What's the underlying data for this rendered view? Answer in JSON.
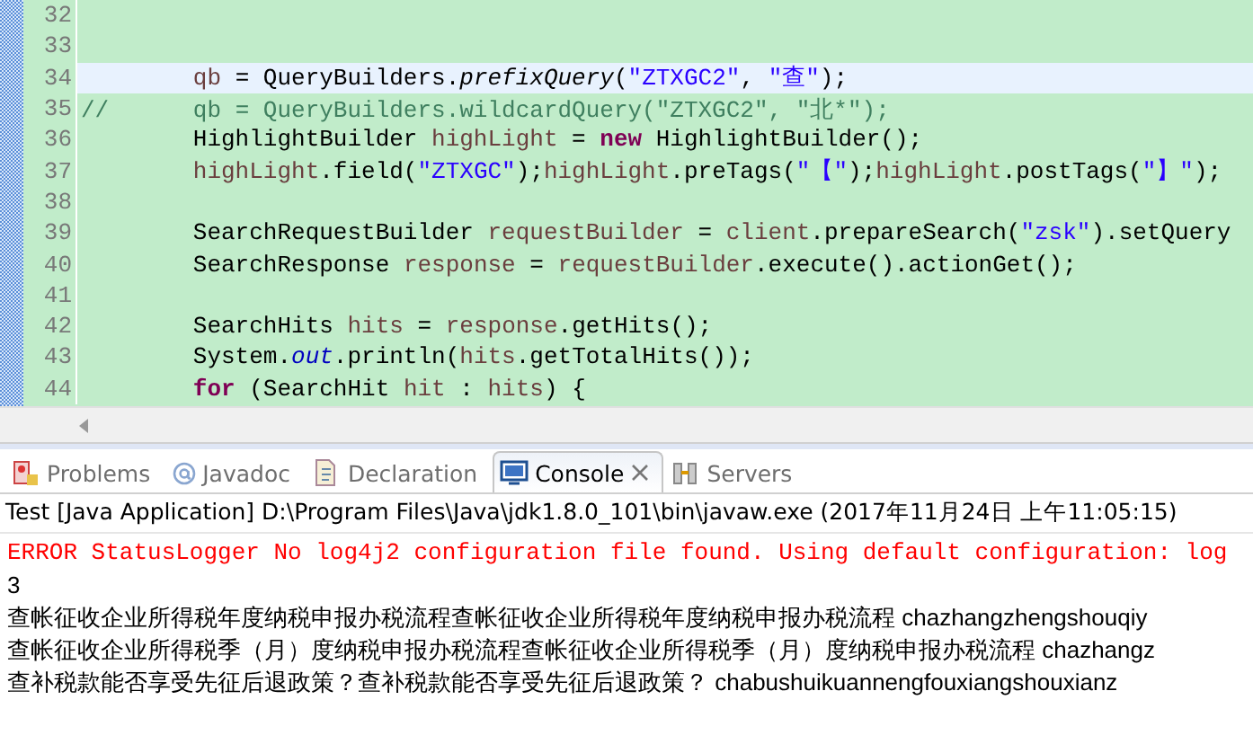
{
  "editor": {
    "lines": [
      {
        "number": "32",
        "selected": false
      },
      {
        "number": "33",
        "selected": false
      },
      {
        "number": "34",
        "selected": true,
        "indent": true,
        "tokens": [
          {
            "kind": "var",
            "text": "qb"
          },
          {
            "kind": "plain",
            "text": " = QueryBuilders."
          },
          {
            "kind": "italic",
            "text": "prefixQuery"
          },
          {
            "kind": "plain",
            "text": "("
          },
          {
            "kind": "string",
            "text": "\"ZTXGC2\""
          },
          {
            "kind": "plain",
            "text": ", "
          },
          {
            "kind": "string",
            "text": "\"查\""
          },
          {
            "kind": "plain",
            "text": ");"
          }
        ]
      },
      {
        "number": "35",
        "selected": false,
        "indent": false,
        "tokens": [
          {
            "kind": "comment",
            "text": "//      qb = QueryBuilders.wildcardQuery(\"ZTXGC2\", \"北*\");"
          }
        ]
      },
      {
        "number": "36",
        "selected": false,
        "indent": true,
        "tokens": [
          {
            "kind": "plain",
            "text": "HighlightBuilder "
          },
          {
            "kind": "var",
            "text": "highLight"
          },
          {
            "kind": "plain",
            "text": " = "
          },
          {
            "kind": "keyword",
            "text": "new"
          },
          {
            "kind": "plain",
            "text": " HighlightBuilder();"
          }
        ]
      },
      {
        "number": "37",
        "selected": false,
        "indent": true,
        "tokens": [
          {
            "kind": "var",
            "text": "highLight"
          },
          {
            "kind": "plain",
            "text": ".field("
          },
          {
            "kind": "string",
            "text": "\"ZTXGC\""
          },
          {
            "kind": "plain",
            "text": ");"
          },
          {
            "kind": "var",
            "text": "highLight"
          },
          {
            "kind": "plain",
            "text": ".preTags("
          },
          {
            "kind": "string",
            "text": "\"【\""
          },
          {
            "kind": "plain",
            "text": ");"
          },
          {
            "kind": "var",
            "text": "highLight"
          },
          {
            "kind": "plain",
            "text": ".postTags("
          },
          {
            "kind": "string",
            "text": "\"】\""
          },
          {
            "kind": "plain",
            "text": ");"
          }
        ]
      },
      {
        "number": "38",
        "selected": false
      },
      {
        "number": "39",
        "selected": false,
        "indent": true,
        "tokens": [
          {
            "kind": "plain",
            "text": "SearchRequestBuilder "
          },
          {
            "kind": "var",
            "text": "requestBuilder"
          },
          {
            "kind": "plain",
            "text": " = "
          },
          {
            "kind": "var",
            "text": "client"
          },
          {
            "kind": "plain",
            "text": ".prepareSearch("
          },
          {
            "kind": "string",
            "text": "\"zsk\""
          },
          {
            "kind": "plain",
            "text": ").setQuery"
          }
        ]
      },
      {
        "number": "40",
        "selected": false,
        "indent": true,
        "tokens": [
          {
            "kind": "plain",
            "text": "SearchResponse "
          },
          {
            "kind": "var",
            "text": "response"
          },
          {
            "kind": "plain",
            "text": " = "
          },
          {
            "kind": "var",
            "text": "requestBuilder"
          },
          {
            "kind": "plain",
            "text": ".execute().actionGet();"
          }
        ]
      },
      {
        "number": "41",
        "selected": false
      },
      {
        "number": "42",
        "selected": false,
        "indent": true,
        "tokens": [
          {
            "kind": "plain",
            "text": "SearchHits "
          },
          {
            "kind": "var",
            "text": "hits"
          },
          {
            "kind": "plain",
            "text": " = "
          },
          {
            "kind": "var",
            "text": "response"
          },
          {
            "kind": "plain",
            "text": ".getHits();"
          }
        ]
      },
      {
        "number": "43",
        "selected": false,
        "indent": true,
        "tokens": [
          {
            "kind": "plain",
            "text": "System."
          },
          {
            "kind": "static",
            "text": "out"
          },
          {
            "kind": "plain",
            "text": ".println("
          },
          {
            "kind": "var",
            "text": "hits"
          },
          {
            "kind": "plain",
            "text": ".getTotalHits());"
          }
        ]
      },
      {
        "number": "44",
        "selected": false,
        "indent": true,
        "tokens": [
          {
            "kind": "keyword",
            "text": "for"
          },
          {
            "kind": "plain",
            "text": " (SearchHit "
          },
          {
            "kind": "var",
            "text": "hit"
          },
          {
            "kind": "plain",
            "text": " : "
          },
          {
            "kind": "var",
            "text": "hits"
          },
          {
            "kind": "plain",
            "text": ") {"
          }
        ]
      }
    ]
  },
  "tabs": [
    {
      "label": "Problems",
      "kind": "problems",
      "selected": false
    },
    {
      "label": "Javadoc",
      "kind": "javadoc",
      "selected": false
    },
    {
      "label": "Declaration",
      "kind": "declaration",
      "selected": false
    },
    {
      "label": "Console",
      "kind": "console",
      "selected": true
    },
    {
      "label": "Servers",
      "kind": "servers",
      "selected": false
    }
  ],
  "console": {
    "header": "Test [Java Application] D:\\Program Files\\Java\\jdk1.8.0_101\\bin\\javaw.exe (2017年11月24日 上午11:05:15)",
    "lines": [
      {
        "kind": "error",
        "text": "ERROR StatusLogger No log4j2 configuration file found. Using default configuration: log"
      },
      {
        "kind": "output",
        "text": "3"
      },
      {
        "kind": "output",
        "text": "查帐征收企业所得税年度纳税申报办税流程查帐征收企业所得税年度纳税申报办税流程 chazhangzhengshouqiy"
      },
      {
        "kind": "output",
        "text": "查帐征收企业所得税季（月）度纳税申报办税流程查帐征收企业所得税季（月）度纳税申报办税流程 chazhangz"
      },
      {
        "kind": "output",
        "text": "查补税款能否享受先征后退政策？查补税款能否享受先征后退政策？ chabushuikuannengfouxiangshouxianz"
      }
    ]
  }
}
